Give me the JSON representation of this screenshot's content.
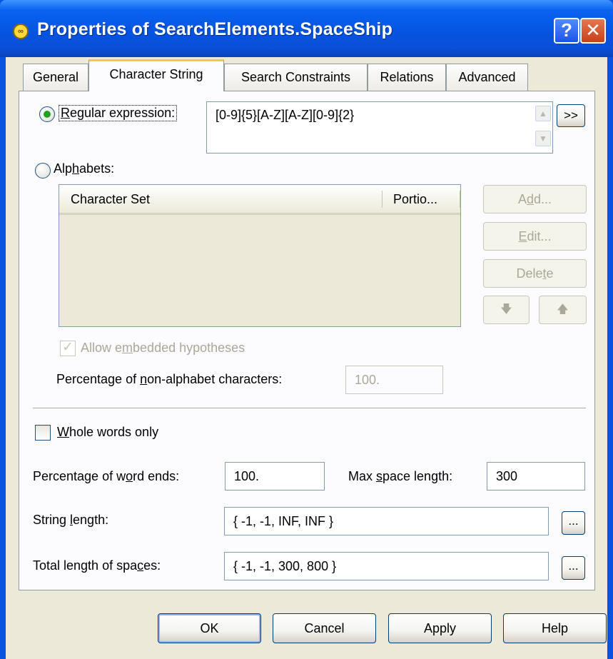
{
  "window": {
    "title": "Properties of SearchElements.SpaceShip",
    "help_glyph": "?",
    "close_glyph": "✕"
  },
  "tabs": [
    {
      "label": "General",
      "active": false
    },
    {
      "label": "Character String",
      "active": true
    },
    {
      "label": "Search Constraints",
      "active": false
    },
    {
      "label": "Relations",
      "active": false
    },
    {
      "label": "Advanced",
      "active": false
    }
  ],
  "regex": {
    "label_pre": "",
    "label_u": "R",
    "label_post": "egular expression:",
    "selected": true,
    "value": "[0-9]{5}[A-Z][A-Z][0-9]{2}",
    "expand_label": ">>"
  },
  "alphabets": {
    "label_pre": "Alp",
    "label_u": "h",
    "label_post": "abets:",
    "selected": false,
    "columns": [
      "Character Set",
      "Portio..."
    ],
    "add_pre": "A",
    "add_u": "d",
    "add_post": "d...",
    "edit_pre": "",
    "edit_u": "E",
    "edit_post": "dit...",
    "delete_pre": "Dele",
    "delete_u": "t",
    "delete_post": "e",
    "down_glyph": "🡇",
    "up_glyph": "🡅"
  },
  "embedded": {
    "label_pre": "Allow e",
    "label_u": "m",
    "label_post": "bedded hypotheses",
    "checked": true
  },
  "non_alphabet": {
    "label_pre": "Percentage of ",
    "label_u": "n",
    "label_post": "on-alphabet characters:",
    "value": "100."
  },
  "whole_words": {
    "label_pre": "",
    "label_u": "W",
    "label_post": "hole words only",
    "checked": false
  },
  "word_ends": {
    "label_pre": "Percentage of w",
    "label_u": "o",
    "label_post": "rd ends:",
    "value": "100."
  },
  "max_space": {
    "label_pre": "Max ",
    "label_u": "s",
    "label_post": "pace length:",
    "value": "300"
  },
  "string_length": {
    "label_pre": "String ",
    "label_u": "l",
    "label_post": "ength:",
    "value": "{ -1, -1, INF, INF }",
    "browse_label": "..."
  },
  "total_spaces": {
    "label_pre": "Total length of spa",
    "label_u": "c",
    "label_post": "es:",
    "value": "{ -1, -1, 300, 800 }",
    "browse_label": "..."
  },
  "buttons": {
    "ok": "OK",
    "cancel": "Cancel",
    "apply": "Apply",
    "help": "Help"
  }
}
